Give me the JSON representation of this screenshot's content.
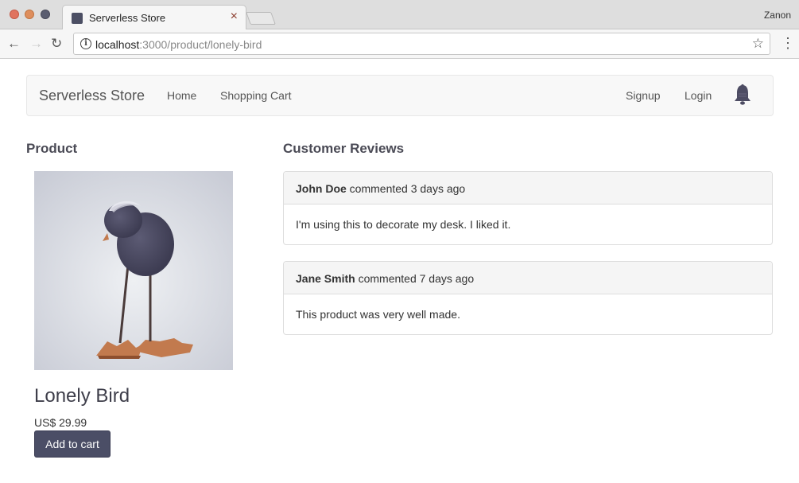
{
  "browser": {
    "tab_title": "Serverless Store",
    "tab_close": "×",
    "profile_name": "Zanon",
    "url_host": "localhost",
    "url_path": ":3000/product/lonely-bird",
    "back_icon": "←",
    "forward_icon": "→",
    "reload_icon": "↻",
    "star_icon": "☆",
    "menu_icon": "⋮",
    "info_icon": "i"
  },
  "navbar": {
    "brand": "Serverless Store",
    "links": [
      "Home",
      "Shopping Cart"
    ],
    "right_links": [
      "Signup",
      "Login"
    ],
    "bell_icon": "bell-icon"
  },
  "product": {
    "heading": "Product",
    "name": "Lonely Bird",
    "price": "US$ 29.99",
    "add_to_cart": "Add to cart"
  },
  "reviews": {
    "heading": "Customer Reviews",
    "items": [
      {
        "author": "John Doe",
        "meta": " commented 3 days ago",
        "comment": "I'm using this to decorate my desk. I liked it."
      },
      {
        "author": "Jane Smith",
        "meta": " commented 7 days ago",
        "comment": "This product was very well made."
      }
    ]
  },
  "colors": {
    "button_bg": "#4b4e66",
    "navbar_bg": "#f8f8f8",
    "bird_body": "#4d4c63",
    "bird_feet": "#c27a4e"
  }
}
